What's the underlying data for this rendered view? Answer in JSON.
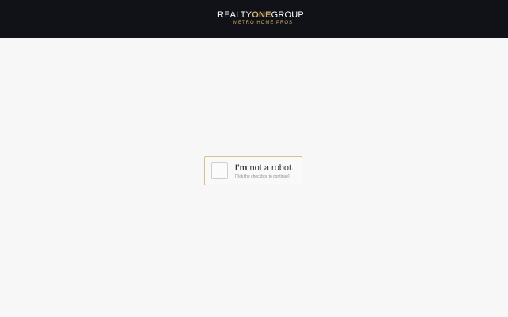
{
  "header": {
    "logo": {
      "part1": "REALTY",
      "part2": "ONE",
      "part3": "GROUP",
      "subtitle": "METRO HOME PROS"
    }
  },
  "captcha": {
    "title_bold": "I'm",
    "title_rest": " not a robot.",
    "hint": "[Tick the checkbox to continue]",
    "checked": false
  },
  "colors": {
    "header_bg": "#111217",
    "accent_gold": "#d4b06a",
    "page_bg": "#f7f7f7"
  }
}
